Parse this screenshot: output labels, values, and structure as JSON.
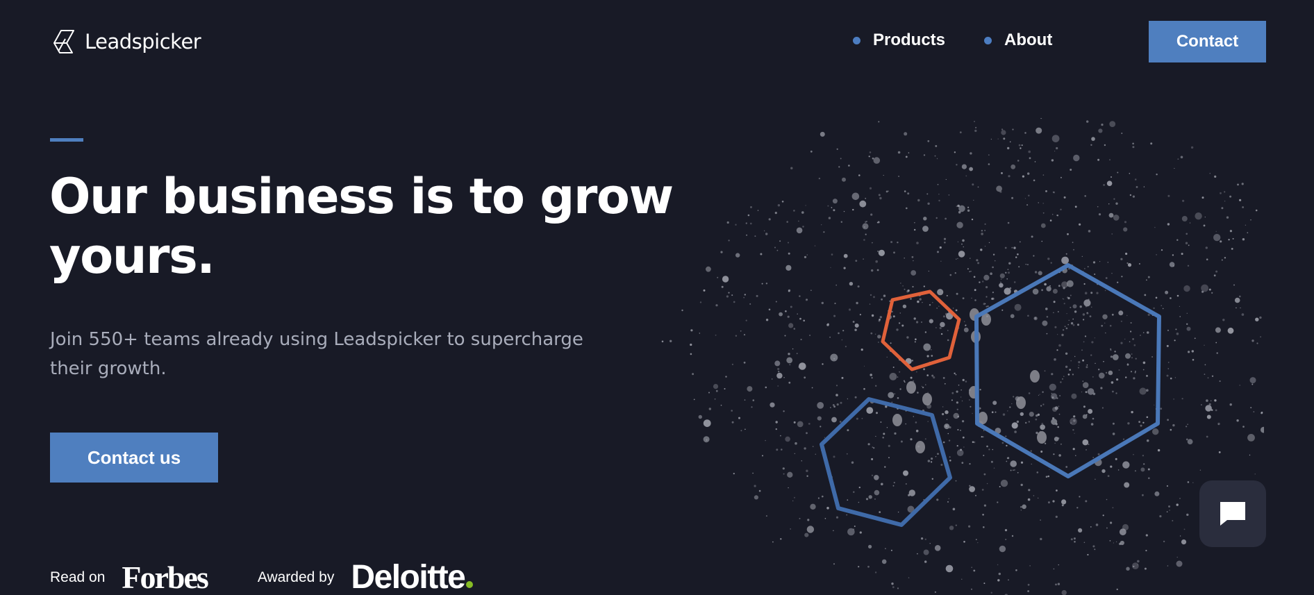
{
  "brand": {
    "name": "Leadspicker",
    "accent_color": "#4f7fbf",
    "background_color": "#181a26"
  },
  "nav": {
    "items": [
      {
        "label": "Products"
      },
      {
        "label": "About"
      }
    ],
    "contact_label": "Contact"
  },
  "hero": {
    "title": "Our business is to grow yours.",
    "subtitle": "Join 550+ teams already using Leadspicker to supercharge their growth.",
    "cta_label": "Contact us"
  },
  "press": {
    "read_on_label": "Read on",
    "forbes_logo_text": "Forbes",
    "awarded_by_label": "Awarded by",
    "deloitte_logo_text": "Deloitte"
  },
  "chat": {
    "icon": "chat-bubble-icon"
  },
  "illustration": {
    "hexagon_colors": [
      "#e0613a",
      "#4a78b8",
      "#3f6aa8"
    ]
  }
}
